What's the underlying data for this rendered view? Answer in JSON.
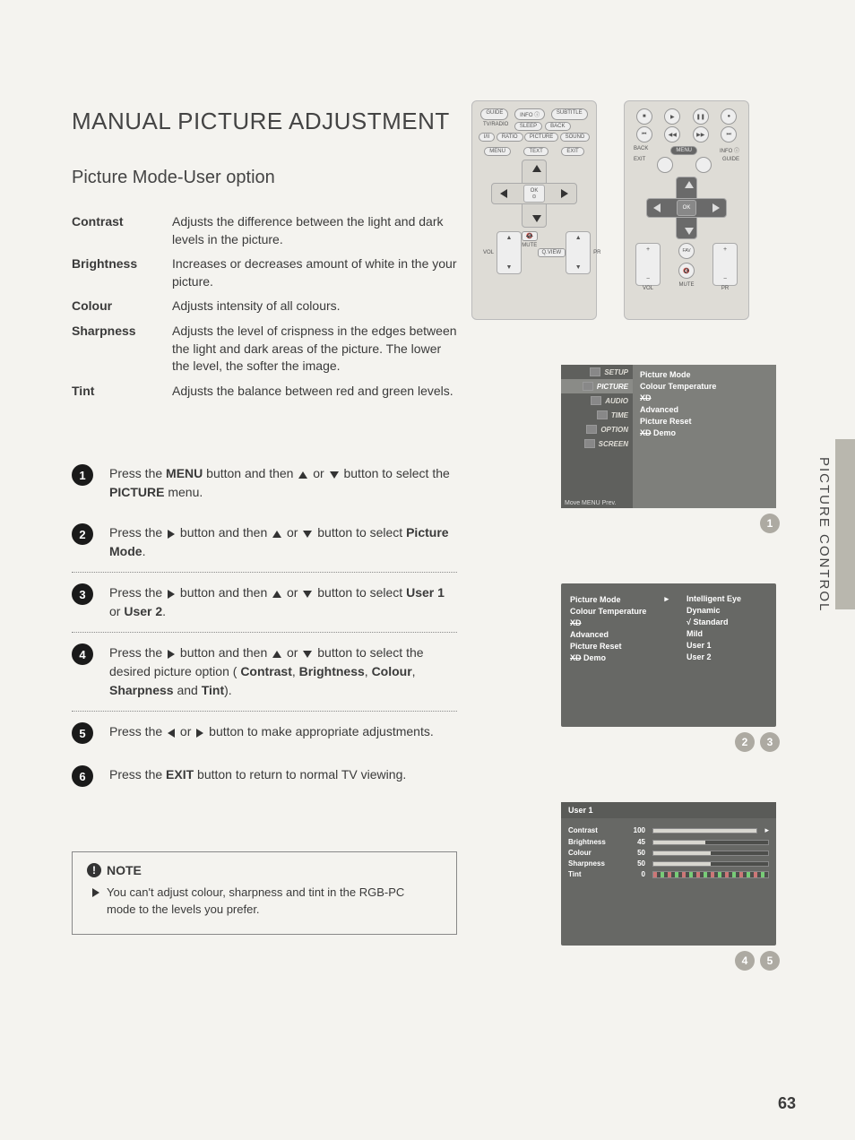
{
  "title": "MANUAL PICTURE ADJUSTMENT",
  "subtitle": "Picture Mode-User option",
  "side_label": "PICTURE CONTROL",
  "page_number": "63",
  "definitions": [
    {
      "term": "Contrast",
      "desc": "Adjusts the difference between the light and dark levels in the picture."
    },
    {
      "term": "Brightness",
      "desc": "Increases or decreases  amount of white in the your picture."
    },
    {
      "term": "Colour",
      "desc": "Adjusts intensity of all colours."
    },
    {
      "term": "Sharpness",
      "desc": "Adjusts the level of crispness in the edges between the light and dark areas of the picture. The lower the level, the softer the image."
    },
    {
      "term": "Tint",
      "desc": "Adjusts the balance between red and green levels."
    }
  ],
  "steps": {
    "s1a": "Press the ",
    "s1b": "MENU",
    "s1c": " button and then ",
    "s1d": " or ",
    "s1e": " button to select the ",
    "s1f": "PICTURE",
    "s1g": " menu.",
    "s2a": "Press the ",
    "s2b": " button and then ",
    "s2c": " or ",
    "s2d": " button to select ",
    "s2e": "Picture Mode",
    "s2f": ".",
    "s3a": "Press the ",
    "s3b": " button and then ",
    "s3c": " or ",
    "s3d": " button to select ",
    "s3e": "User 1",
    "s3f": " or ",
    "s3g": "User 2",
    "s3h": ".",
    "s4a": "Press the ",
    "s4b": " button and then ",
    "s4c": " or ",
    "s4d": " button to select the desired picture option (",
    "s4e": "Contrast",
    "s4f": ", ",
    "s4g": "Brightness",
    "s4h": ", ",
    "s4i": "Colour",
    "s4j": ", ",
    "s4k": "Sharpness",
    "s4l": " and ",
    "s4m": "Tint",
    "s4n": ").",
    "s5a": "Press the ",
    "s5b": " or ",
    "s5c": " button to make appropriate adjustments.",
    "s6a": "Press the ",
    "s6b": "EXIT",
    "s6c": " button to return to normal TV viewing."
  },
  "note": {
    "title": "NOTE",
    "body": "You can't adjust colour, sharpness and tint in the RGB-PC mode to the levels you prefer."
  },
  "remote1": {
    "row1": [
      "GUIDE",
      "INFO ⓘ",
      "SUBTITLE"
    ],
    "row2": [
      "SLEEP",
      "BACK"
    ],
    "row2_left": "TV/RADIO",
    "row3": [
      "I/II",
      "RATIO",
      "PICTURE",
      "SOUND"
    ],
    "row4": [
      "MENU",
      "TEXT",
      "EXIT"
    ],
    "ok": "OK",
    "vol": "VOL",
    "pr": "PR",
    "mute": "MUTE",
    "qview": "Q.VIEW"
  },
  "remote2": {
    "labels": {
      "back": "BACK",
      "exit": "EXIT",
      "menu": "MENU",
      "info": "INFO ⓘ",
      "guide": "GUIDE",
      "ok": "OK",
      "vol": "VOL",
      "pr": "PR",
      "fav": "FAV",
      "mute": "MUTE"
    }
  },
  "osd1": {
    "menu": [
      "SETUP",
      "PICTURE",
      "AUDIO",
      "TIME",
      "OPTION",
      "SCREEN"
    ],
    "active_index": 1,
    "items": [
      "Picture Mode",
      "Colour Temperature",
      "XD",
      "Advanced",
      "Picture Reset",
      "XD Demo"
    ],
    "footer": "Move    MENU  Prev.",
    "badge": "1"
  },
  "osd2": {
    "left": [
      "Picture Mode",
      "Colour Temperature",
      "XD",
      "Advanced",
      "Picture Reset",
      "XD Demo"
    ],
    "right": [
      "Intelligent Eye",
      "Dynamic",
      "Standard",
      "Mild",
      "User 1",
      "User 2"
    ],
    "selected_right_index": 2,
    "badges": [
      "2",
      "3"
    ]
  },
  "osd3": {
    "header": "User 1",
    "rows": [
      {
        "label": "Contrast",
        "value": 100,
        "pct": 100
      },
      {
        "label": "Brightness",
        "value": 45,
        "pct": 45
      },
      {
        "label": "Colour",
        "value": 50,
        "pct": 50
      },
      {
        "label": "Sharpness",
        "value": 50,
        "pct": 50
      },
      {
        "label": "Tint",
        "value": 0,
        "pct": 50
      }
    ],
    "badges": [
      "4",
      "5"
    ]
  },
  "chart_data": {
    "type": "bar",
    "title": "User 1",
    "categories": [
      "Contrast",
      "Brightness",
      "Colour",
      "Sharpness",
      "Tint"
    ],
    "values": [
      100,
      45,
      50,
      50,
      0
    ],
    "ylim": [
      0,
      100
    ],
    "xlabel": "",
    "ylabel": ""
  }
}
